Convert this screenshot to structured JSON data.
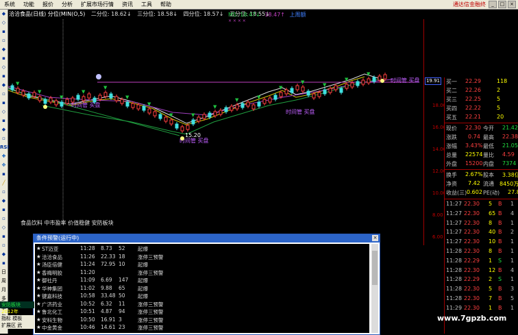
{
  "menu": {
    "items": [
      "系统",
      "功能",
      "报价",
      "分析",
      "扩展市场行情",
      "资讯",
      "工具",
      "帮助"
    ],
    "brand": "通达信金融终"
  },
  "left_toolbar": [
    "",
    "",
    "",
    "",
    "",
    "",
    "",
    "",
    "",
    "",
    "",
    "",
    "",
    "",
    "",
    "",
    "RSI",
    "",
    "",
    "",
    "",
    "",
    "",
    "",
    "",
    "",
    "",
    "",
    "",
    "",
    "日",
    "周",
    "月",
    "多",
    "季",
    "年"
  ],
  "infobar": {
    "title": "洽洽食品(日线) 分位(MIN(O,5)",
    "items": [
      "二分位: 18.62↓",
      "三分位: 18.58↓",
      "四分位: 18.57↓",
      "五分位: 18.55↓"
    ],
    "ma_m5": "M5: 18.47↓",
    "ma_other": "18.47↑",
    "ma_other2": "上周额",
    "marks": "× × × ×"
  },
  "chart_labels": {
    "buy1": "时间管 买盘",
    "buy2": "时间管 买盘",
    "buy3": "时间管 买盘",
    "buy4": "时间管 买盘",
    "low": "15.20"
  },
  "sectors": "食品饮料 中市盈率 价值稳健 安防板块",
  "axis": {
    "price_label": "19.91",
    "ticks": [
      "18.00",
      "16.00",
      "14.00",
      "12.00",
      "10.00",
      "8.00",
      "6.00",
      "4.00",
      "2.00"
    ]
  },
  "quote": {
    "bids": [
      {
        "label": "买一",
        "price": "22.29",
        "vol": "118"
      },
      {
        "label": "买二",
        "price": "22.26",
        "vol": "2"
      },
      {
        "label": "买三",
        "price": "22.25",
        "vol": "5"
      },
      {
        "label": "买四",
        "price": "22.22",
        "vol": "5"
      },
      {
        "label": "买五",
        "price": "22.21",
        "vol": "20"
      }
    ],
    "stats": [
      {
        "l1": "现价",
        "v1": "22.30",
        "l2": "今开",
        "v2": "21.42"
      },
      {
        "l1": "涨跌",
        "v1": "0.74",
        "l2": "最高",
        "v2": "22.38"
      },
      {
        "l1": "涨幅",
        "v1": "3.43%",
        "l2": "最低",
        "v2": "21.05"
      },
      {
        "l1": "总量",
        "v1": "22574",
        "l2": "量比",
        "v2": "4.59"
      },
      {
        "l1": "外盘",
        "v1": "15200",
        "l2": "内盘",
        "v2": "7374"
      },
      {
        "l1": "换手",
        "v1": "2.67%",
        "l2": "股本",
        "v2": "3.38亿"
      },
      {
        "l1": "净资",
        "v1": "7.42",
        "l2": "流通",
        "v2": "8450万"
      },
      {
        "l1": "收益(三)",
        "v1": "0.602",
        "l2": "PE(动)",
        "v2": "27.8"
      }
    ],
    "ticks": [
      {
        "time": "11:27",
        "price": "22.30",
        "vol": "5",
        "dir": "B",
        "sign": "1"
      },
      {
        "time": "11:27",
        "price": "22.30",
        "vol": "65",
        "dir": "B",
        "sign": "4"
      },
      {
        "time": "11:27",
        "price": "22.30",
        "vol": "8",
        "dir": "B",
        "sign": "1"
      },
      {
        "time": "11:27",
        "price": "22.30",
        "vol": "40",
        "dir": "B",
        "sign": "2"
      },
      {
        "time": "11:27",
        "price": "22.30",
        "vol": "10",
        "dir": "B",
        "sign": "1"
      },
      {
        "time": "11:28",
        "price": "22.30",
        "vol": "8",
        "dir": "B",
        "sign": "1"
      },
      {
        "time": "11:28",
        "price": "22.29",
        "vol": "1",
        "dir": "S",
        "sign": "1"
      },
      {
        "time": "11:28",
        "price": "22.30",
        "vol": "12",
        "dir": "B",
        "sign": "4"
      },
      {
        "time": "11:28",
        "price": "22.29",
        "vol": "2",
        "dir": "S",
        "sign": "1"
      },
      {
        "time": "11:28",
        "price": "22.30",
        "vol": "5",
        "dir": "B",
        "sign": "3"
      },
      {
        "time": "11:28",
        "price": "22.30",
        "vol": "7",
        "dir": "B",
        "sign": "5"
      },
      {
        "time": "11:29",
        "price": "22.30",
        "vol": "1",
        "dir": "B",
        "sign": "1"
      }
    ]
  },
  "alert": {
    "title": "条件预警(运行中)",
    "rows": [
      {
        "name": "ST迈亚",
        "time": "11:28",
        "price": "8.73",
        "count": "52",
        "type": "起爆"
      },
      {
        "name": "洽洽食品",
        "time": "11:26",
        "price": "22.33",
        "count": "18",
        "type": "涨停三预警"
      },
      {
        "name": "汤臣倍健",
        "time": "11:24",
        "price": "72.95",
        "count": "10",
        "type": "起爆"
      },
      {
        "name": "香梅明胶",
        "time": "11:20",
        "price": "",
        "count": "",
        "type": "涨停三预警"
      },
      {
        "name": "御社丹",
        "time": "11:09",
        "price": "6.69",
        "count": "147",
        "type": "起爆"
      },
      {
        "name": "华神集团",
        "time": "11:02",
        "price": "9.88",
        "count": "65",
        "type": "起爆"
      },
      {
        "name": "键嘉科技",
        "time": "10:58",
        "price": "33.48",
        "count": "50",
        "type": "起爆"
      },
      {
        "name": "广济药业",
        "time": "10:52",
        "price": "6.32",
        "count": "11",
        "type": "涨停三预警"
      },
      {
        "name": "鲁北化工",
        "time": "10:51",
        "price": "4.87",
        "count": "94",
        "type": "涨停三预警"
      },
      {
        "name": "安科生物",
        "time": "10:50",
        "price": "16.91",
        "count": "3",
        "type": "涨停三预警"
      },
      {
        "name": "中金黄金",
        "time": "10:46",
        "price": "14.61",
        "count": "23",
        "type": "涨停三预警"
      }
    ]
  },
  "bottom_tabs": [
    "安防板块",
    "2012年",
    "指标 模板",
    "扩展区 武"
  ],
  "watermark": "www.7gpzb.com"
}
